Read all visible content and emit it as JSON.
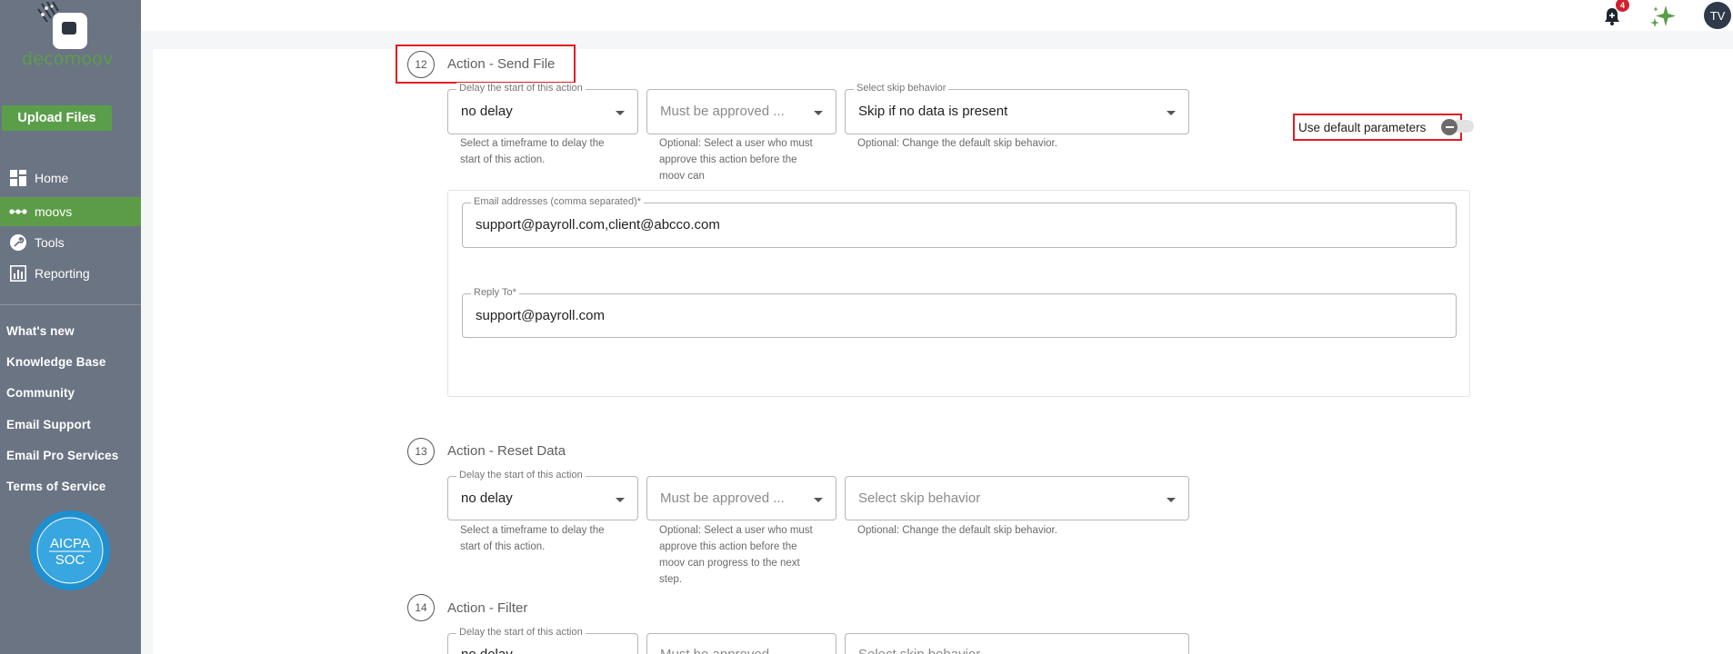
{
  "brand": {
    "logo_text": "decomoov",
    "accent": "#5a9e4a"
  },
  "sidebar": {
    "upload_label": "Upload Files",
    "nav": [
      {
        "label": "Home",
        "icon": "grid-icon"
      },
      {
        "label": "moovs",
        "icon": "dots-icon"
      },
      {
        "label": "Tools",
        "icon": "wrench-icon"
      },
      {
        "label": "Reporting",
        "icon": "chart-icon"
      }
    ],
    "links": [
      "What's new",
      "Knowledge Base",
      "Community",
      "Email Support",
      "Email Pro Services",
      "Terms of Service"
    ],
    "badge": {
      "line1": "AICPA",
      "line2": "SOC"
    }
  },
  "topbar": {
    "notification_count": "4",
    "avatar_initials": "TV"
  },
  "steps": [
    {
      "number": "12",
      "title": "Action - Send File",
      "delay": {
        "label": "Delay the start of this action",
        "value": "no delay",
        "helper": "Select a timeframe to delay the start of this action."
      },
      "approval": {
        "placeholder": "Must be approved ...",
        "helper": "Optional: Select a user who must approve this action before the moov can"
      },
      "skip": {
        "label": "Select skip behavior",
        "value": "Skip if no data is present",
        "helper": "Optional: Change the default skip behavior."
      },
      "default_params_label": "Use default parameters",
      "email": {
        "label": "Email addresses (comma separated)*",
        "value": "support@payroll.com,client@abcco.com"
      },
      "reply_to": {
        "label": "Reply To*",
        "value": "support@payroll.com"
      }
    },
    {
      "number": "13",
      "title": "Action - Reset Data",
      "delay": {
        "label": "Delay the start of this action",
        "value": "no delay",
        "helper": "Select a timeframe to delay the start of this action."
      },
      "approval": {
        "placeholder": "Must be approved ...",
        "helper": "Optional: Select a user who must approve this action before the moov can progress to the next step."
      },
      "skip": {
        "placeholder": "Select skip behavior",
        "helper": "Optional: Change the default skip behavior."
      }
    },
    {
      "number": "14",
      "title": "Action - Filter",
      "delay": {
        "label": "Delay the start of this action",
        "value": "no delay"
      },
      "approval": {
        "placeholder": "Must be approved ..."
      },
      "skip": {
        "placeholder": "Select skip behavior"
      }
    }
  ]
}
